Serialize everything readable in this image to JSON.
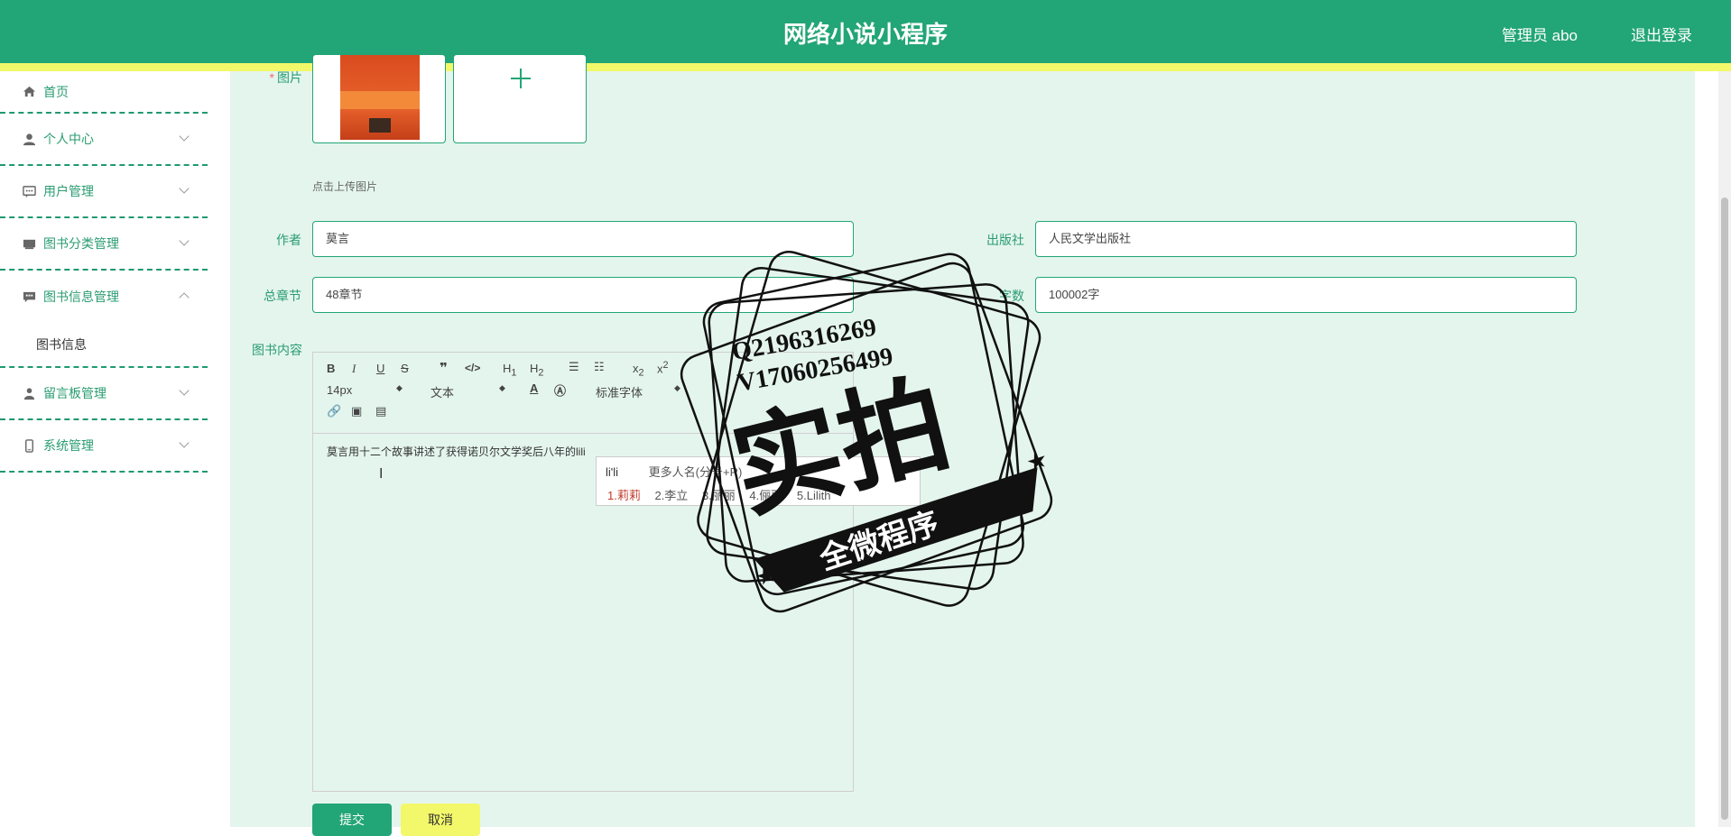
{
  "header": {
    "title": "网络小说小程序",
    "admin_label": "管理员 abo",
    "logout_label": "退出登录"
  },
  "sidebar": {
    "items": [
      {
        "label": "首页",
        "icon": "home-icon"
      },
      {
        "label": "个人中心",
        "icon": "user-icon"
      },
      {
        "label": "用户管理",
        "icon": "chat-icon"
      },
      {
        "label": "图书分类管理",
        "icon": "book-icon"
      },
      {
        "label": "图书信息管理",
        "icon": "message-icon",
        "expanded": true,
        "children": [
          {
            "label": "图书信息"
          }
        ]
      },
      {
        "label": "留言板管理",
        "icon": "person-icon"
      },
      {
        "label": "系统管理",
        "icon": "phone-icon"
      }
    ]
  },
  "form": {
    "image_label": "图片",
    "upload_tip": "点击上传图片",
    "author": {
      "label": "作者",
      "value": "莫言"
    },
    "publisher": {
      "label": "出版社",
      "value": "人民文学出版社"
    },
    "chapters": {
      "label": "总章节",
      "value": "48章节"
    },
    "words": {
      "label": "字数",
      "value": "100002字"
    },
    "content": {
      "label": "图书内容",
      "text": "莫言用十二个故事讲述了获得诺贝尔文学奖后八年的lili"
    },
    "submit_label": "提交",
    "cancel_label": "取消"
  },
  "editor_toolbar": {
    "font_size": "14px",
    "text_style": "文本",
    "font_family": "标准字体"
  },
  "ime": {
    "input": "li'li",
    "hint": "更多人名(分号+R)",
    "candidates": [
      "1.莉莉",
      "2.李立",
      "3.丽丽",
      "4.俪丽",
      "5.Lilith"
    ]
  },
  "watermark": {
    "line1": "Q2196316269",
    "line2": "V17060256499",
    "main": "实拍",
    "banner": "全微程序"
  },
  "colors": {
    "primary": "#22a577",
    "accent_yellow": "#f3f76a",
    "background": "#e4f5ee"
  }
}
